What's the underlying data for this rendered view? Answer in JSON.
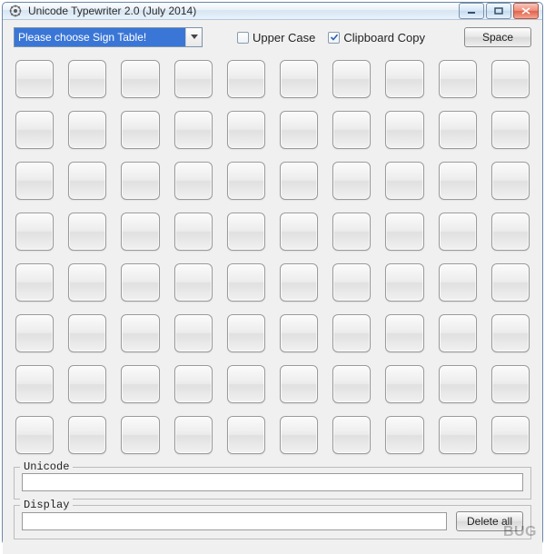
{
  "window": {
    "title": "Unicode Typewriter 2.0 (July 2014)"
  },
  "controls": {
    "signTable": {
      "selected": "Please choose Sign Table!"
    },
    "upperCase": {
      "label": "Upper Case",
      "checked": false
    },
    "clipboardCopy": {
      "label": "Clipboard Copy",
      "checked": true
    },
    "space": {
      "label": "Space"
    },
    "deleteAll": {
      "label": "Delete all"
    }
  },
  "fields": {
    "unicode": {
      "label": "Unicode",
      "value": ""
    },
    "display": {
      "label": "Display",
      "value": ""
    }
  },
  "grid": {
    "rows": 8,
    "cols": 10
  },
  "watermark": "BUG"
}
